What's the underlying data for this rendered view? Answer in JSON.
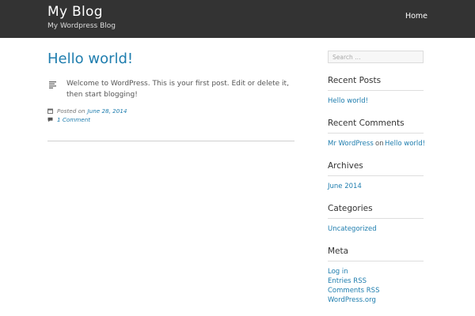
{
  "header": {
    "site_title": "My Blog",
    "site_description": "My Wordpress Blog",
    "nav_home": "Home"
  },
  "post": {
    "title": "Hello world!",
    "content": "Welcome to WordPress. This is your first post. Edit or delete it, then start blogging!",
    "posted_prefix": "Posted on",
    "posted_date": "June 28, 2014",
    "comments_link": "1 Comment",
    "format_icon": "standard-format-icon",
    "date_icon": "calendar-icon",
    "comment_icon": "comment-icon"
  },
  "sidebar": {
    "search_placeholder": "Search …",
    "recent_posts": {
      "title": "Recent Posts",
      "items": [
        "Hello world!"
      ]
    },
    "recent_comments": {
      "title": "Recent Comments",
      "author": "Mr WordPress",
      "on": "on",
      "post": "Hello world!"
    },
    "archives": {
      "title": "Archives",
      "items": [
        "June 2014"
      ]
    },
    "categories": {
      "title": "Categories",
      "items": [
        "Uncategorized"
      ]
    },
    "meta": {
      "title": "Meta",
      "items": [
        "Log in",
        "Entries RSS",
        "Comments RSS",
        "WordPress.org"
      ]
    }
  },
  "colors": {
    "header_bg": "#333333",
    "link": "#1e7dae",
    "text": "#555555"
  }
}
